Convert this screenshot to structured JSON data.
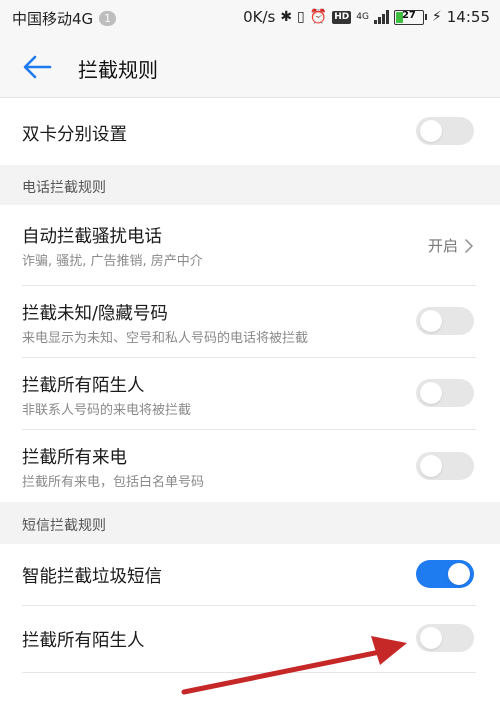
{
  "status_bar": {
    "carrier": "中国移动4G",
    "sim_badge": "1",
    "net_speed": "0K/s",
    "signal_label": "4G",
    "battery": "27",
    "battery_level": 0.27,
    "time": "14:55"
  },
  "toolbar": {
    "title": "拦截规则"
  },
  "dual_sim": {
    "title": "双卡分别设置",
    "on": false
  },
  "call_section": {
    "header": "电话拦截规则",
    "items": [
      {
        "title": "自动拦截骚扰电话",
        "subtitle": "诈骗, 骚扰, 广告推销, 房产中介",
        "value": "开启"
      },
      {
        "title": "拦截未知/隐藏号码",
        "subtitle": "来电显示为未知、空号和私人号码的电话将被拦截",
        "on": false
      },
      {
        "title": "拦截所有陌生人",
        "subtitle": "非联系人号码的来电将被拦截",
        "on": false
      },
      {
        "title": "拦截所有来电",
        "subtitle": "拦截所有来电，包括白名单号码",
        "on": false
      }
    ]
  },
  "sms_section": {
    "header": "短信拦截规则",
    "items": [
      {
        "title": "智能拦截垃圾短信",
        "on": true
      },
      {
        "title": "拦截所有陌生人",
        "on": false
      }
    ]
  },
  "colors": {
    "accent": "#1e7bf0",
    "annotation_arrow": "#c62828"
  },
  "icons": {
    "back": "back-arrow-icon",
    "chevron": "chevron-right-icon"
  }
}
